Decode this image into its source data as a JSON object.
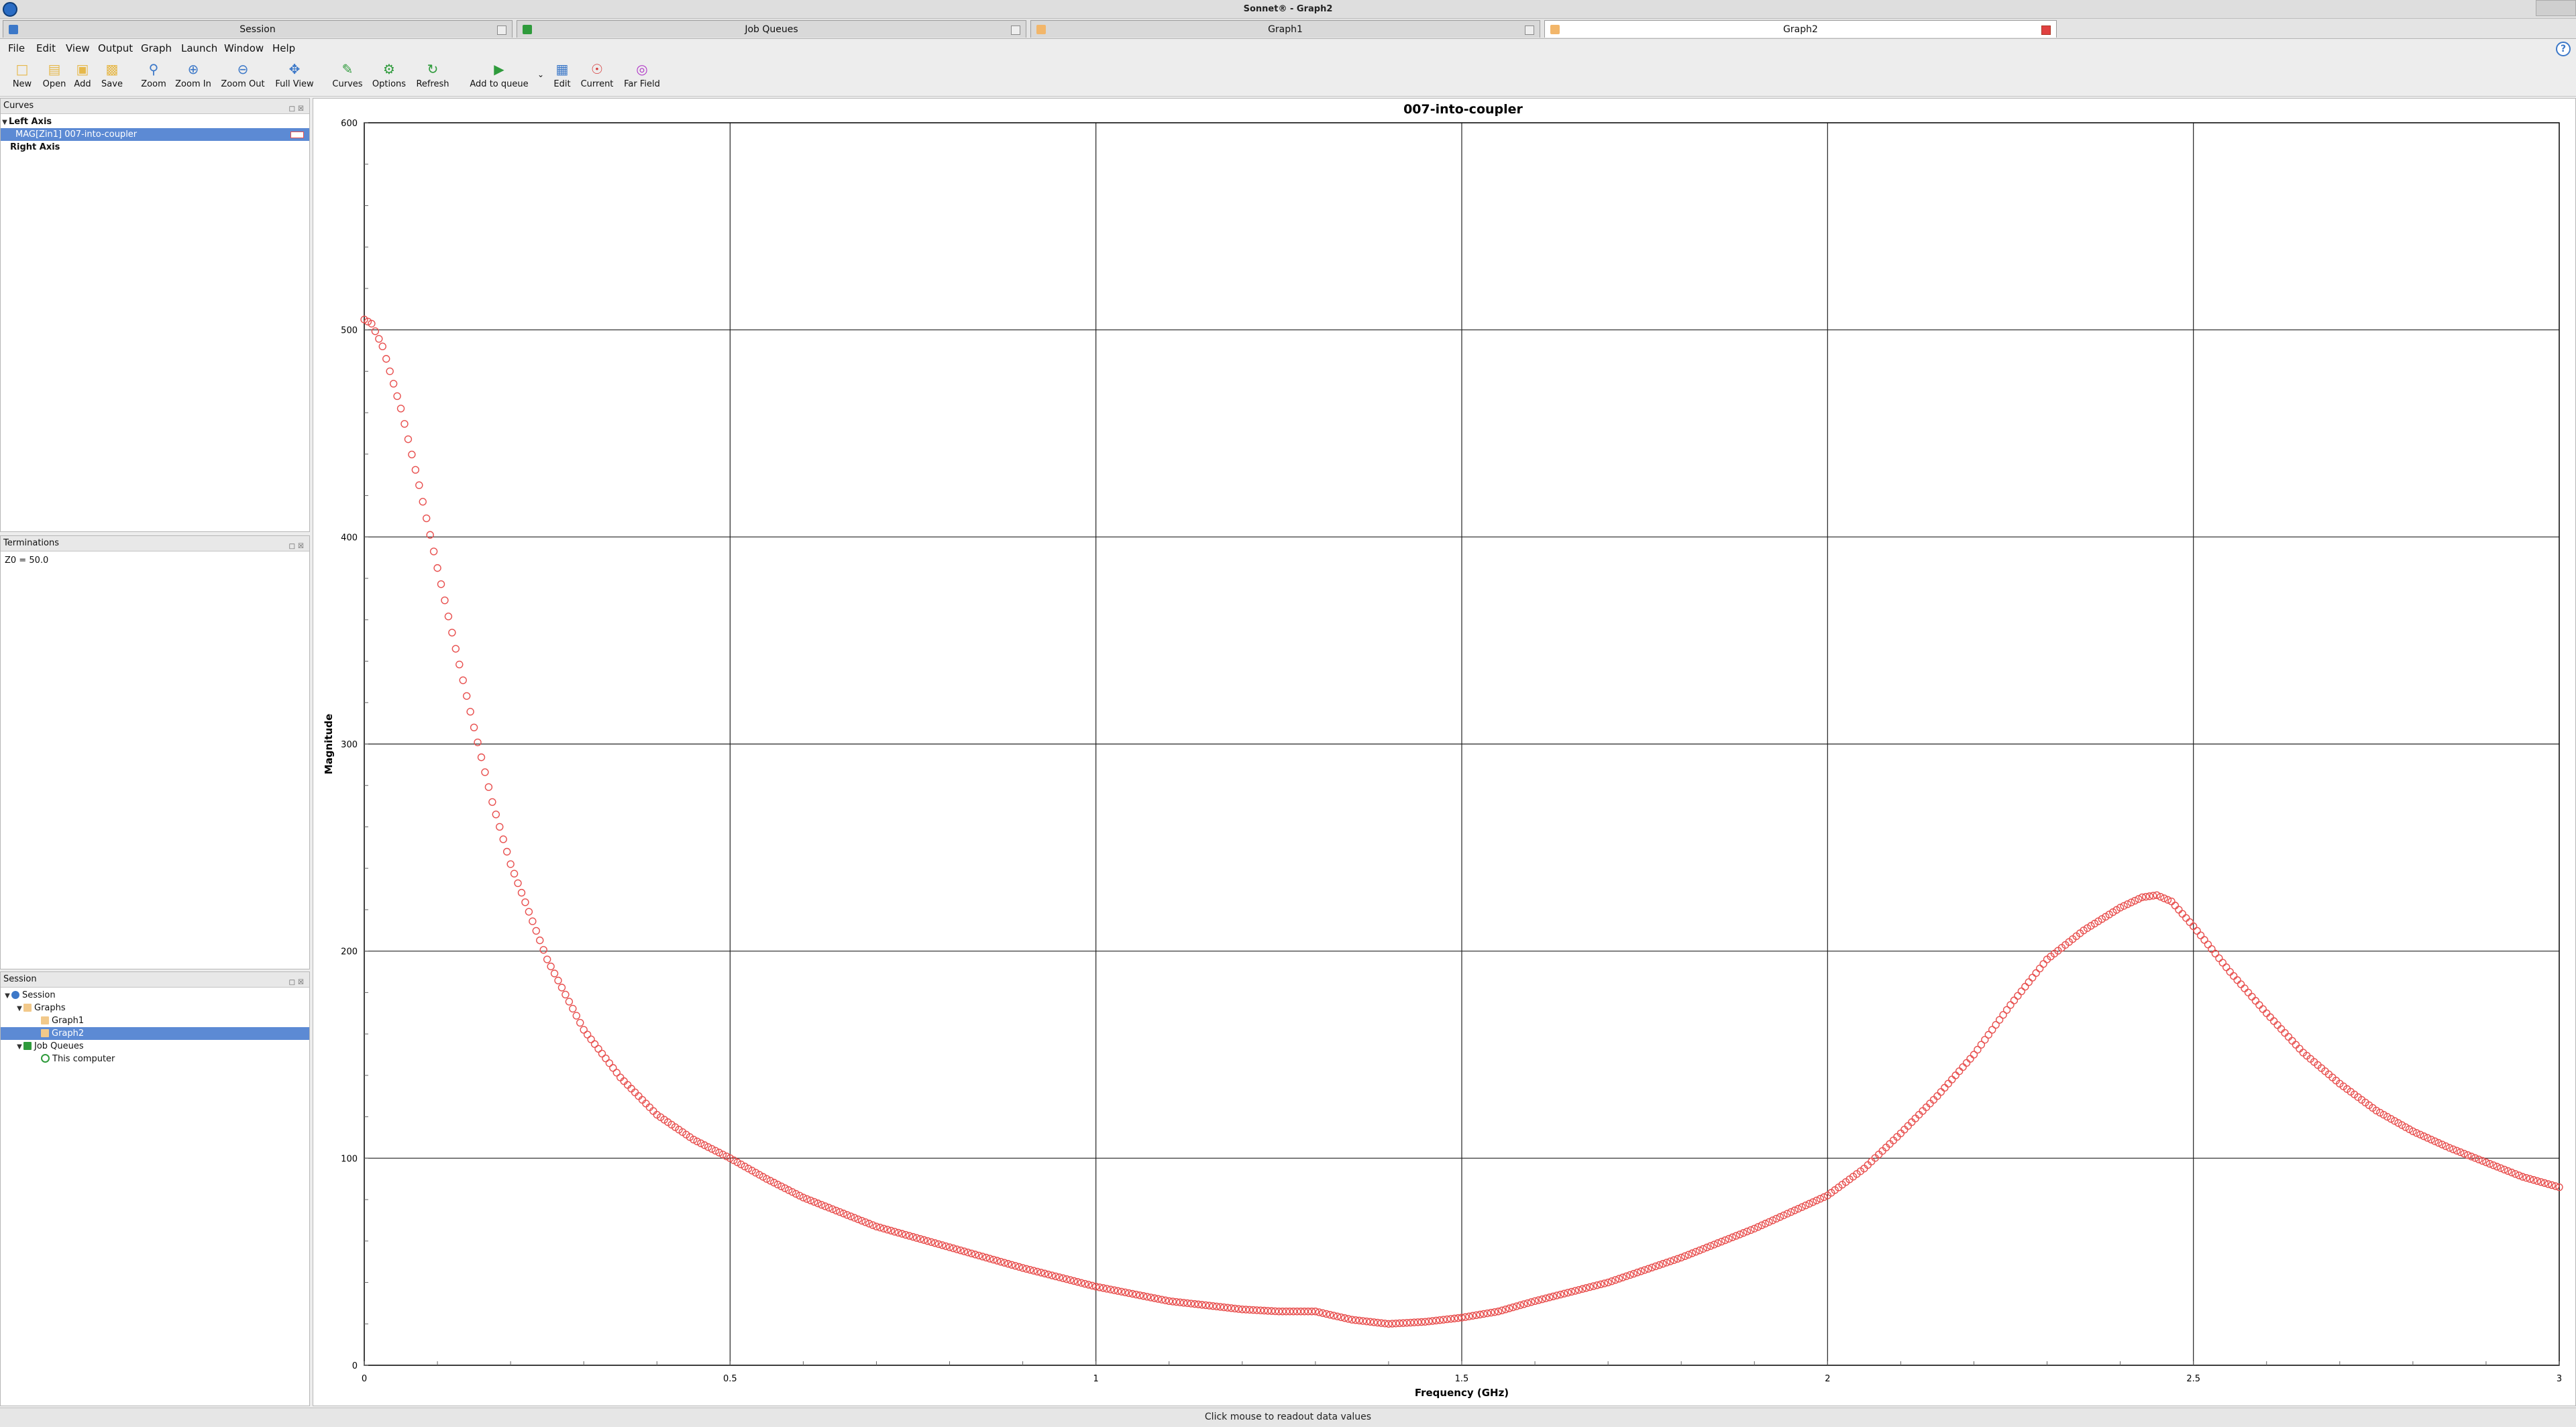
{
  "window": {
    "title": "Sonnet® - Graph2"
  },
  "tabs": [
    {
      "label": "Session",
      "icon": "session-icon"
    },
    {
      "label": "Job Queues",
      "icon": "job-queues-icon"
    },
    {
      "label": "Graph1",
      "icon": "graph-icon"
    },
    {
      "label": "Graph2",
      "icon": "graph-icon",
      "active": true
    }
  ],
  "menu": [
    "File",
    "Edit",
    "View",
    "Output",
    "Graph",
    "Launch",
    "Window",
    "Help"
  ],
  "help_glyph": "?",
  "toolbar": [
    {
      "label": "New",
      "icon": "new-file-icon"
    },
    {
      "label": "Open",
      "icon": "open-folder-icon"
    },
    {
      "label": "Add",
      "icon": "add-icon"
    },
    {
      "label": "Save",
      "icon": "save-icon"
    },
    {
      "label": "Zoom",
      "icon": "zoom-icon"
    },
    {
      "label": "Zoom In",
      "icon": "zoom-in-icon"
    },
    {
      "label": "Zoom Out",
      "icon": "zoom-out-icon"
    },
    {
      "label": "Full View",
      "icon": "full-view-icon"
    },
    {
      "label": "Curves",
      "icon": "curves-icon"
    },
    {
      "label": "Options",
      "icon": "options-icon"
    },
    {
      "label": "Refresh",
      "icon": "refresh-icon"
    },
    {
      "label": "Add to queue",
      "icon": "add-to-queue-icon"
    },
    {
      "label": "Edit",
      "icon": "edit-icon"
    },
    {
      "label": "Current",
      "icon": "current-icon"
    },
    {
      "label": "Far Field",
      "icon": "far-field-icon"
    }
  ],
  "panels": {
    "curves": {
      "title": "Curves",
      "left_axis": "Left Axis",
      "curve_item": "MAG[Zin1] 007-into-coupler",
      "right_axis": "Right Axis"
    },
    "terminations": {
      "title": "Terminations",
      "z0": "Z0 = 50.0"
    },
    "session": {
      "title": "Session",
      "tree": {
        "session": "Session",
        "graphs": "Graphs",
        "graph1": "Graph1",
        "graph2": "Graph2",
        "job_queues": "Job Queues",
        "this_computer": "This computer"
      }
    }
  },
  "status": "Click mouse to readout data values",
  "colors": {
    "curve": "#e8504f",
    "selection": "#5c8ad4"
  },
  "chart_data": {
    "type": "scatter",
    "title": "007-into-coupler",
    "xlabel": "Frequency (GHz)",
    "ylabel": "Magnitude",
    "xlim": [
      0,
      3
    ],
    "ylim": [
      0,
      600
    ],
    "xticks": [
      "0",
      "0.5",
      "1",
      "1.5",
      "2",
      "2.5",
      "3"
    ],
    "yticks": [
      "0",
      "100",
      "200",
      "300",
      "400",
      "500",
      "600"
    ],
    "grid": true,
    "series": [
      {
        "marker": "circle",
        "x": [
          0,
          0.01,
          0.025,
          0.05,
          0.075,
          0.1,
          0.125,
          0.15,
          0.175,
          0.2,
          0.25,
          0.3,
          0.35,
          0.4,
          0.45,
          0.5,
          0.55,
          0.6,
          0.65,
          0.7,
          0.8,
          0.9,
          1.0,
          1.1,
          1.2,
          1.25,
          1.28,
          1.3,
          1.35,
          1.4,
          1.45,
          1.5,
          1.55,
          1.6,
          1.7,
          1.8,
          1.9,
          2.0,
          2.05,
          2.1,
          2.15,
          2.2,
          2.25,
          2.3,
          2.35,
          2.4,
          2.43,
          2.45,
          2.47,
          2.5,
          2.55,
          2.6,
          2.65,
          2.7,
          2.75,
          2.8,
          2.85,
          2.9,
          2.95,
          3.0
        ],
        "y": [
          505,
          503,
          492,
          462,
          425,
          385,
          346,
          308,
          272,
          242,
          196,
          162,
          139,
          121,
          109,
          100,
          90,
          81,
          74,
          67,
          57,
          47,
          38,
          31,
          27,
          26,
          26,
          26,
          22,
          20,
          21,
          23,
          26,
          31,
          40,
          52,
          66,
          82,
          95,
          112,
          130,
          150,
          174,
          196,
          210,
          221,
          226,
          227,
          224,
          212,
          190,
          170,
          151,
          136,
          123,
          113,
          105,
          98,
          91,
          86
        ]
      }
    ]
  }
}
